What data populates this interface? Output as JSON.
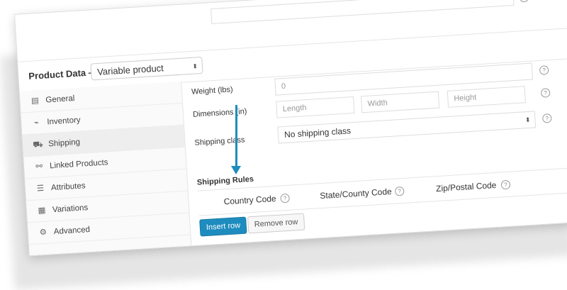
{
  "product_data": {
    "title": "Product Data —",
    "type_select": "Variable product"
  },
  "sidebar": {
    "items": [
      {
        "label": "General",
        "icon": "document-icon",
        "glyph": "▤"
      },
      {
        "label": "Inventory",
        "icon": "chart-icon",
        "glyph": "⌁"
      },
      {
        "label": "Shipping",
        "icon": "truck-icon",
        "glyph": "⛟"
      },
      {
        "label": "Linked Products",
        "icon": "link-icon",
        "glyph": "⚯"
      },
      {
        "label": "Attributes",
        "icon": "list-icon",
        "glyph": "☰"
      },
      {
        "label": "Variations",
        "icon": "calendar-icon",
        "glyph": "▦"
      },
      {
        "label": "Advanced",
        "icon": "gear-icon",
        "glyph": "⚙"
      }
    ],
    "active": "Shipping"
  },
  "shipping": {
    "weight_label": "Weight (lbs)",
    "weight_placeholder": "0",
    "dimensions_label": "Dimensions (in)",
    "length_placeholder": "Length",
    "width_placeholder": "Width",
    "height_placeholder": "Height",
    "class_label": "Shipping class",
    "class_value": "No shipping class"
  },
  "rules": {
    "title": "Shipping Rules",
    "columns": [
      "Country Code",
      "State/County Code",
      "Zip/Postal Code"
    ],
    "insert_label": "Insert row",
    "remove_label": "Remove row"
  },
  "help_glyph": "?",
  "select_arrows": "⬍",
  "colors": {
    "accent": "#1e8cbe"
  }
}
